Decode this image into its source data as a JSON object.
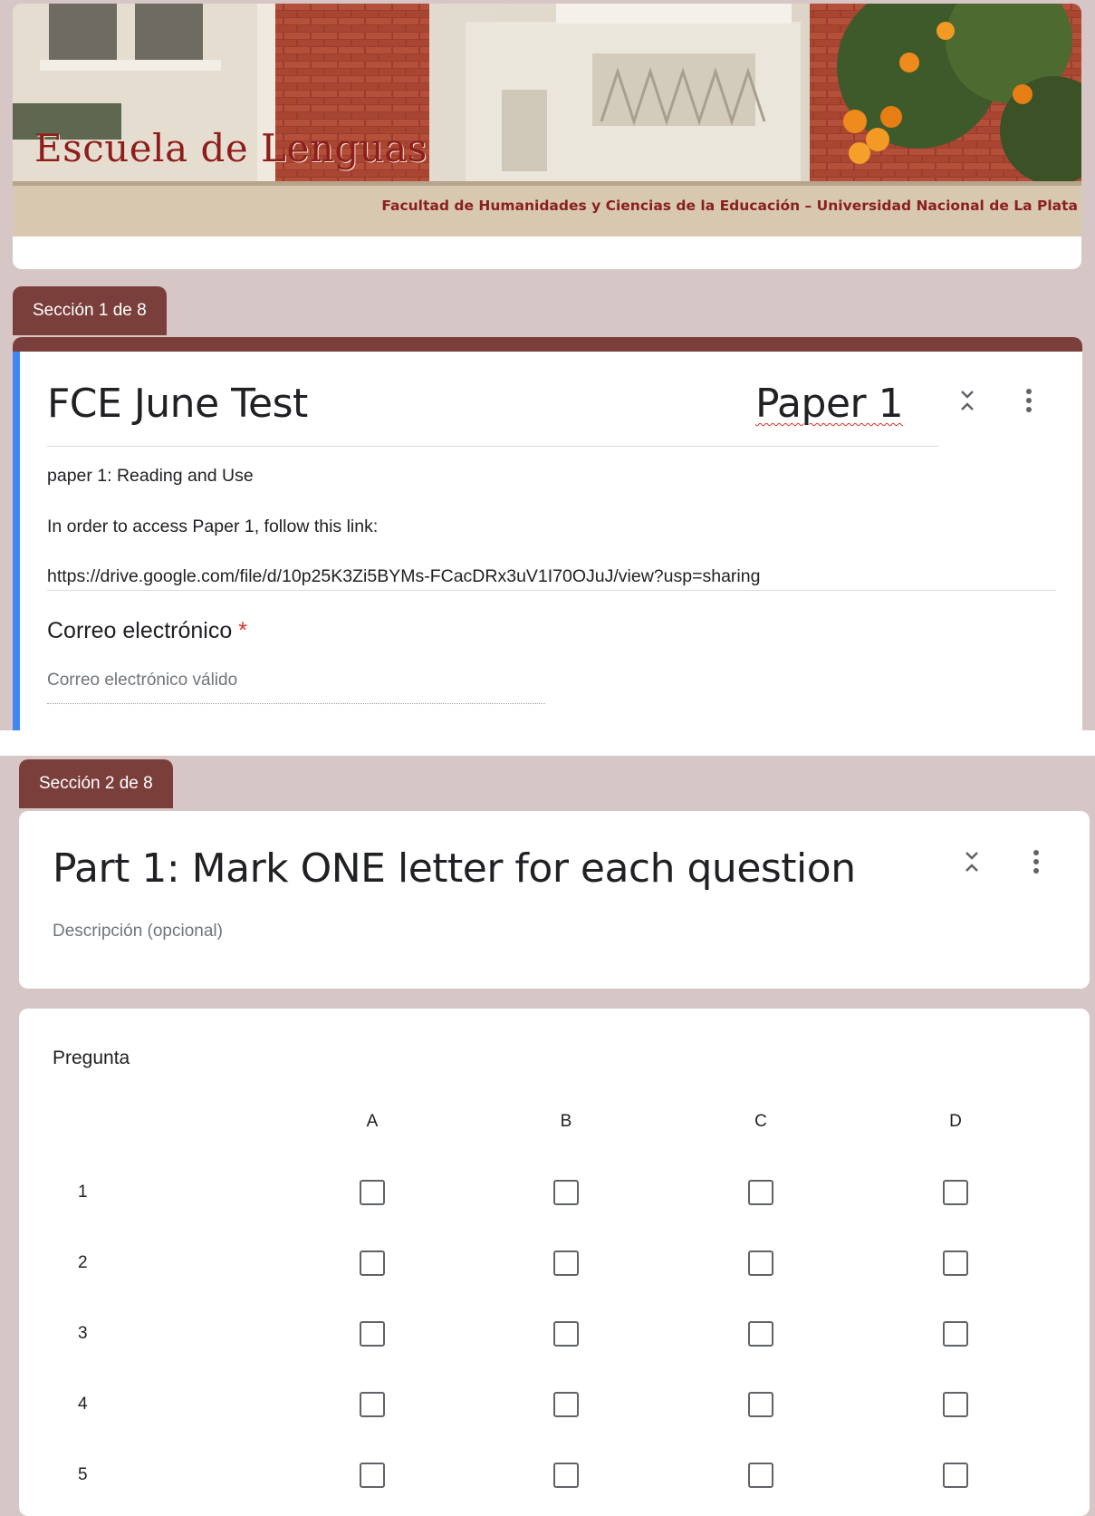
{
  "header": {
    "school_name": "Escuela de Lenguas",
    "subtitle": "Facultad de Humanidades y Ciencias de la Educación – Universidad Nacional de La Plata"
  },
  "section1": {
    "tab_label": "Sección 1 de 8",
    "title": "FCE June Test",
    "title_right": "Paper 1",
    "description_line1": "paper 1: Reading and Use",
    "description_line2": "In order to access Paper 1, follow this link:",
    "link": "https://drive.google.com/file/d/10p25K3Zi5BYMs-FCacDRx3uV1I70OJuJ/view?usp=sharing",
    "email_label": "Correo electrónico",
    "required_mark": "*",
    "email_placeholder": "Correo electrónico válido"
  },
  "section2": {
    "tab_label": "Sección 2 de 8",
    "title": "Part 1: Mark ONE letter for each question",
    "description_placeholder": "Descripción (opcional)"
  },
  "question": {
    "label": "Pregunta",
    "columns": [
      "A",
      "B",
      "C",
      "D"
    ],
    "rows": [
      "1",
      "2",
      "3",
      "4",
      "5"
    ]
  },
  "icons": {
    "collapse": "collapse-icon",
    "more": "more-vert-icon"
  },
  "colors": {
    "page_bg": "#d7c6c6",
    "section_tab": "#7a3f3a",
    "accent_blue": "#4285f4",
    "required_red": "#d93025"
  }
}
